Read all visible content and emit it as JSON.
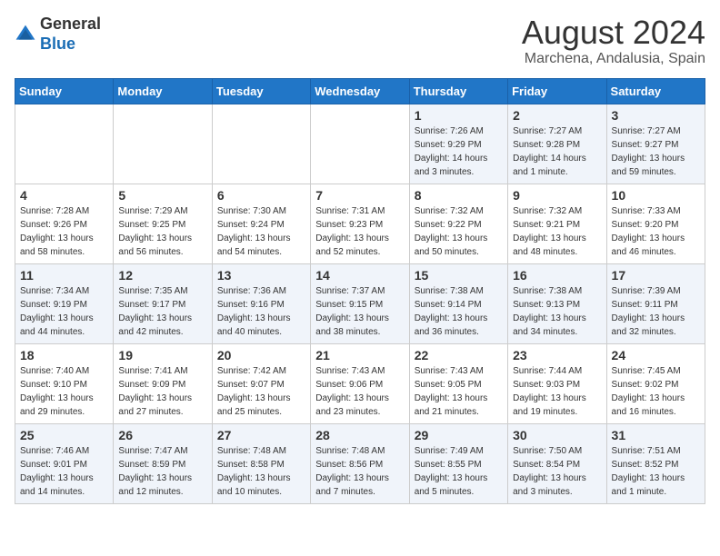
{
  "header": {
    "logo_general": "General",
    "logo_blue": "Blue",
    "month_year": "August 2024",
    "location": "Marchena, Andalusia, Spain"
  },
  "weekdays": [
    "Sunday",
    "Monday",
    "Tuesday",
    "Wednesday",
    "Thursday",
    "Friday",
    "Saturday"
  ],
  "weeks": [
    [
      {
        "day": "",
        "info": ""
      },
      {
        "day": "",
        "info": ""
      },
      {
        "day": "",
        "info": ""
      },
      {
        "day": "",
        "info": ""
      },
      {
        "day": "1",
        "info": "Sunrise: 7:26 AM\nSunset: 9:29 PM\nDaylight: 14 hours\nand 3 minutes."
      },
      {
        "day": "2",
        "info": "Sunrise: 7:27 AM\nSunset: 9:28 PM\nDaylight: 14 hours\nand 1 minute."
      },
      {
        "day": "3",
        "info": "Sunrise: 7:27 AM\nSunset: 9:27 PM\nDaylight: 13 hours\nand 59 minutes."
      }
    ],
    [
      {
        "day": "4",
        "info": "Sunrise: 7:28 AM\nSunset: 9:26 PM\nDaylight: 13 hours\nand 58 minutes."
      },
      {
        "day": "5",
        "info": "Sunrise: 7:29 AM\nSunset: 9:25 PM\nDaylight: 13 hours\nand 56 minutes."
      },
      {
        "day": "6",
        "info": "Sunrise: 7:30 AM\nSunset: 9:24 PM\nDaylight: 13 hours\nand 54 minutes."
      },
      {
        "day": "7",
        "info": "Sunrise: 7:31 AM\nSunset: 9:23 PM\nDaylight: 13 hours\nand 52 minutes."
      },
      {
        "day": "8",
        "info": "Sunrise: 7:32 AM\nSunset: 9:22 PM\nDaylight: 13 hours\nand 50 minutes."
      },
      {
        "day": "9",
        "info": "Sunrise: 7:32 AM\nSunset: 9:21 PM\nDaylight: 13 hours\nand 48 minutes."
      },
      {
        "day": "10",
        "info": "Sunrise: 7:33 AM\nSunset: 9:20 PM\nDaylight: 13 hours\nand 46 minutes."
      }
    ],
    [
      {
        "day": "11",
        "info": "Sunrise: 7:34 AM\nSunset: 9:19 PM\nDaylight: 13 hours\nand 44 minutes."
      },
      {
        "day": "12",
        "info": "Sunrise: 7:35 AM\nSunset: 9:17 PM\nDaylight: 13 hours\nand 42 minutes."
      },
      {
        "day": "13",
        "info": "Sunrise: 7:36 AM\nSunset: 9:16 PM\nDaylight: 13 hours\nand 40 minutes."
      },
      {
        "day": "14",
        "info": "Sunrise: 7:37 AM\nSunset: 9:15 PM\nDaylight: 13 hours\nand 38 minutes."
      },
      {
        "day": "15",
        "info": "Sunrise: 7:38 AM\nSunset: 9:14 PM\nDaylight: 13 hours\nand 36 minutes."
      },
      {
        "day": "16",
        "info": "Sunrise: 7:38 AM\nSunset: 9:13 PM\nDaylight: 13 hours\nand 34 minutes."
      },
      {
        "day": "17",
        "info": "Sunrise: 7:39 AM\nSunset: 9:11 PM\nDaylight: 13 hours\nand 32 minutes."
      }
    ],
    [
      {
        "day": "18",
        "info": "Sunrise: 7:40 AM\nSunset: 9:10 PM\nDaylight: 13 hours\nand 29 minutes."
      },
      {
        "day": "19",
        "info": "Sunrise: 7:41 AM\nSunset: 9:09 PM\nDaylight: 13 hours\nand 27 minutes."
      },
      {
        "day": "20",
        "info": "Sunrise: 7:42 AM\nSunset: 9:07 PM\nDaylight: 13 hours\nand 25 minutes."
      },
      {
        "day": "21",
        "info": "Sunrise: 7:43 AM\nSunset: 9:06 PM\nDaylight: 13 hours\nand 23 minutes."
      },
      {
        "day": "22",
        "info": "Sunrise: 7:43 AM\nSunset: 9:05 PM\nDaylight: 13 hours\nand 21 minutes."
      },
      {
        "day": "23",
        "info": "Sunrise: 7:44 AM\nSunset: 9:03 PM\nDaylight: 13 hours\nand 19 minutes."
      },
      {
        "day": "24",
        "info": "Sunrise: 7:45 AM\nSunset: 9:02 PM\nDaylight: 13 hours\nand 16 minutes."
      }
    ],
    [
      {
        "day": "25",
        "info": "Sunrise: 7:46 AM\nSunset: 9:01 PM\nDaylight: 13 hours\nand 14 minutes."
      },
      {
        "day": "26",
        "info": "Sunrise: 7:47 AM\nSunset: 8:59 PM\nDaylight: 13 hours\nand 12 minutes."
      },
      {
        "day": "27",
        "info": "Sunrise: 7:48 AM\nSunset: 8:58 PM\nDaylight: 13 hours\nand 10 minutes."
      },
      {
        "day": "28",
        "info": "Sunrise: 7:48 AM\nSunset: 8:56 PM\nDaylight: 13 hours\nand 7 minutes."
      },
      {
        "day": "29",
        "info": "Sunrise: 7:49 AM\nSunset: 8:55 PM\nDaylight: 13 hours\nand 5 minutes."
      },
      {
        "day": "30",
        "info": "Sunrise: 7:50 AM\nSunset: 8:54 PM\nDaylight: 13 hours\nand 3 minutes."
      },
      {
        "day": "31",
        "info": "Sunrise: 7:51 AM\nSunset: 8:52 PM\nDaylight: 13 hours\nand 1 minute."
      }
    ]
  ]
}
